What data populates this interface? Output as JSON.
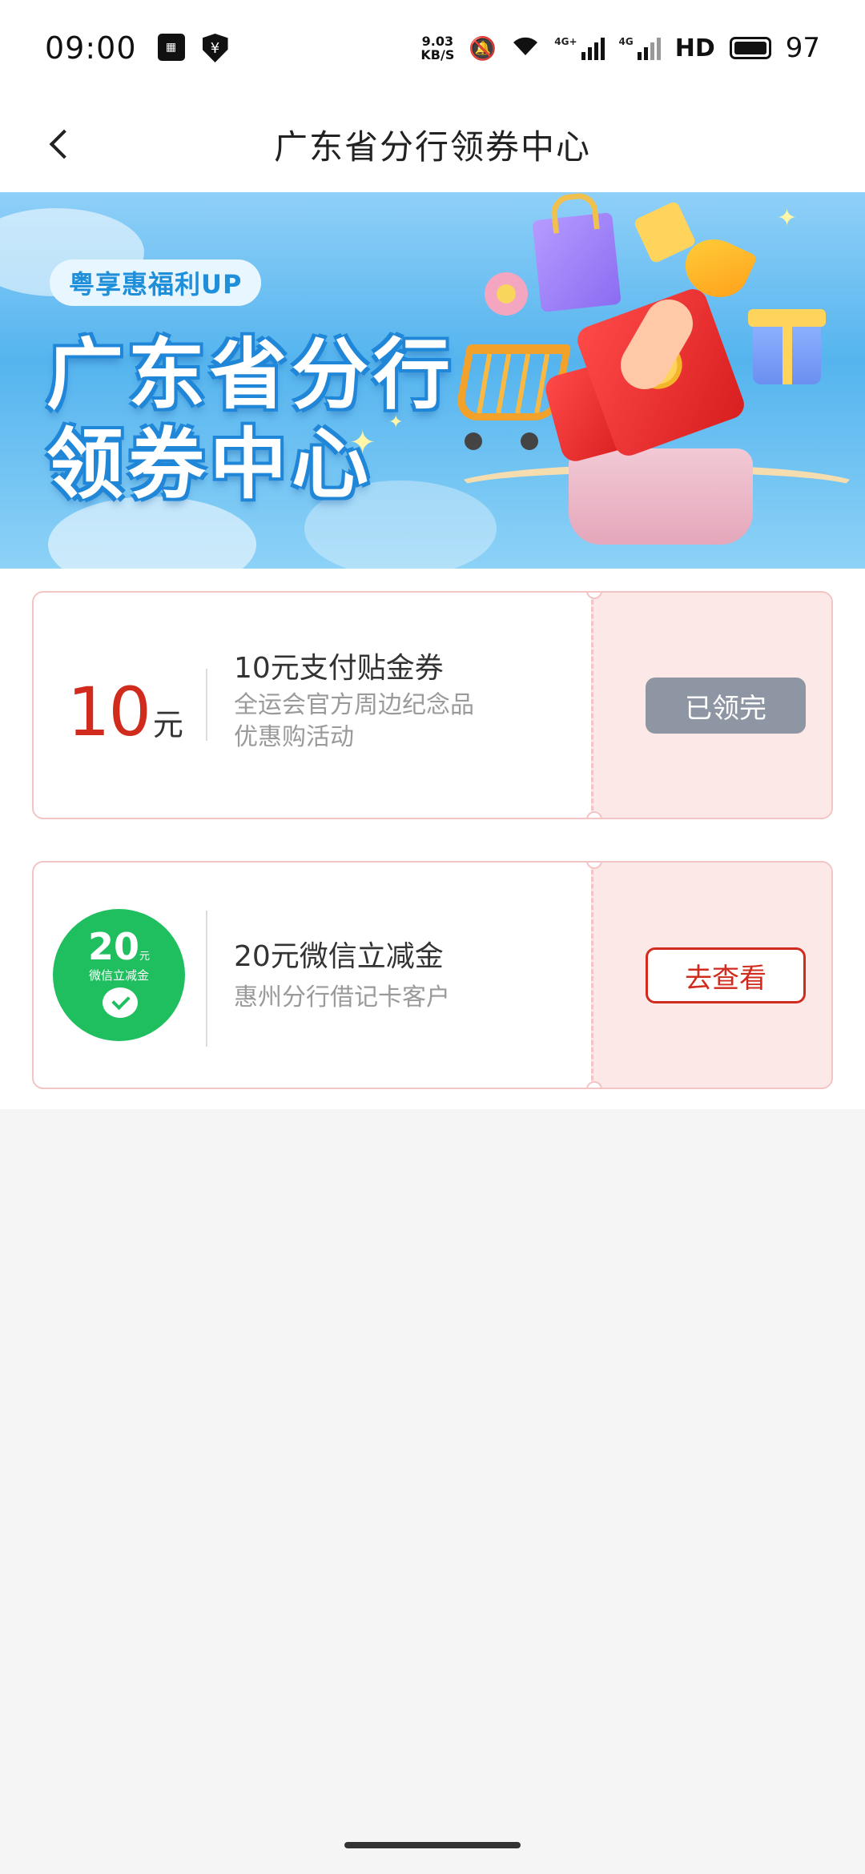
{
  "status_bar": {
    "time": "09:00",
    "net_speed_value": "9.03",
    "net_speed_unit": "KB/S",
    "network_1": "4G+",
    "network_2": "4G",
    "hd_label": "HD",
    "battery": "97",
    "icons": [
      "news-icon",
      "wallet-shield-icon",
      "mute-icon",
      "wifi-icon",
      "signal-icon",
      "battery-icon"
    ]
  },
  "nav": {
    "title": "广东省分行领券中心",
    "back_icon": "chevron-left-icon"
  },
  "banner": {
    "pill": "粤享惠福利UP",
    "title_line1": "广东省分行",
    "title_line2": "领券中心"
  },
  "coupons": [
    {
      "amount": "10",
      "unit": "元",
      "title": "10元支付贴金券",
      "desc_line1": "全运会官方周边纪念品",
      "desc_line2": "优惠购活动",
      "button": "已领完"
    },
    {
      "badge_amount": "20",
      "badge_unit": "元",
      "badge_sub": "微信立减金",
      "title": "20元微信立减金",
      "desc_line1": "惠州分行借记卡客户",
      "button": "去查看"
    }
  ],
  "colors": {
    "accent_red": "#d12b1e",
    "coupon_border": "#f3c4c4",
    "coupon_side_bg": "#fde8e8",
    "disabled_button": "#8e96a3",
    "wechat_green": "#1fbf5f"
  }
}
